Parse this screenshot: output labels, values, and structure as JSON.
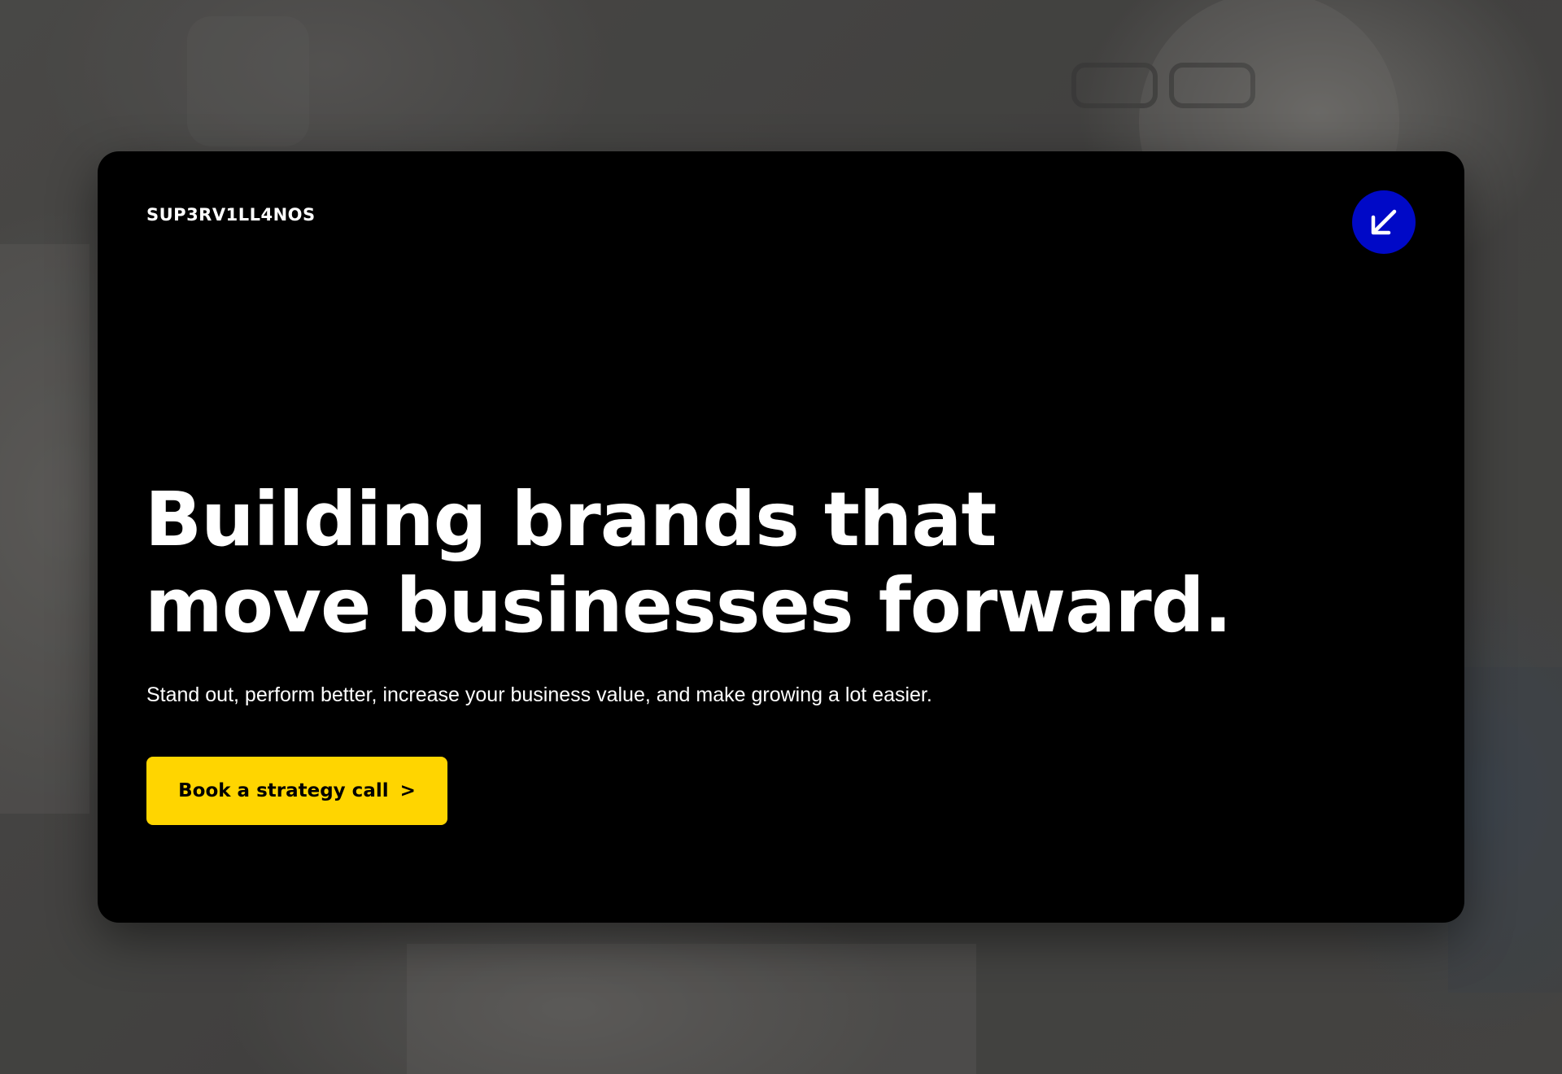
{
  "brand": {
    "logo_text": "SUP3RV1LL4NOS"
  },
  "hero": {
    "headline_line1": "Building brands that",
    "headline_line2": "move businesses forward.",
    "subtext": "Stand out, perform better, increase your business value, and make growing a lot easier.",
    "cta_label": "Book a strategy call",
    "cta_arrow": ">"
  },
  "corner_button": {
    "icon": "arrow-down-left-icon"
  },
  "colors": {
    "card_background": "#000000",
    "accent_blue": "#0009c7",
    "cta_yellow": "#ffd500",
    "text_white": "#ffffff"
  }
}
